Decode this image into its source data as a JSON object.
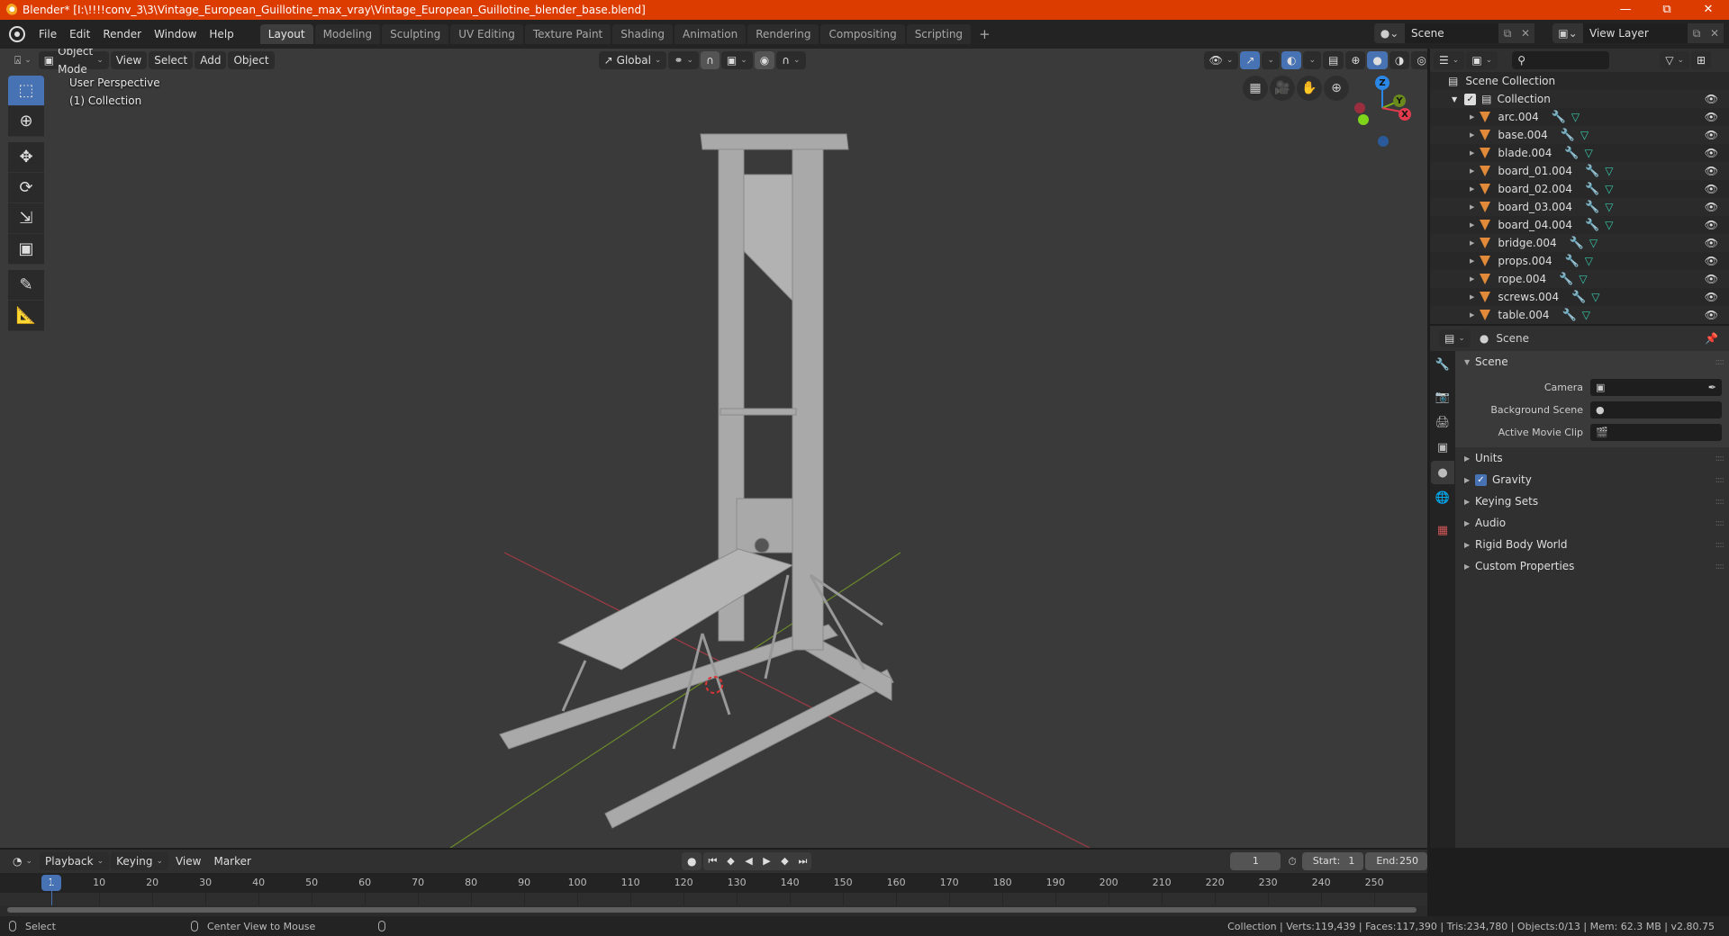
{
  "window": {
    "title": "Blender* [I:\\!!!!conv_3\\3\\Vintage_European_Guillotine_max_vray\\Vintage_European_Guillotine_blender_base.blend]",
    "controls": [
      "minimize",
      "restore",
      "close"
    ]
  },
  "menu": {
    "items": [
      "File",
      "Edit",
      "Render",
      "Window",
      "Help"
    ]
  },
  "workspaces": {
    "tabs": [
      "Layout",
      "Modeling",
      "Sculpting",
      "UV Editing",
      "Texture Paint",
      "Shading",
      "Animation",
      "Rendering",
      "Compositing",
      "Scripting"
    ],
    "active": "Layout",
    "add_label": "+"
  },
  "scene_selector": {
    "name": "Scene"
  },
  "view_layer_selector": {
    "name": "View Layer"
  },
  "viewport_header": {
    "mode": "Object Mode",
    "menus": [
      "View",
      "Select",
      "Add",
      "Object"
    ],
    "orientation": "Global"
  },
  "viewport": {
    "perspective_label": "User Perspective",
    "collection_label": "(1) Collection",
    "gizmo_axes": [
      "Z",
      "Y",
      "X"
    ],
    "colors": {
      "x_axis": "#e23b4e",
      "y_axis": "#7fb515",
      "z_axis": "#2b87e6",
      "background": "#3a3a3a"
    }
  },
  "tools": [
    "select-box",
    "cursor",
    "move",
    "rotate",
    "scale",
    "transform",
    "annotate",
    "measure"
  ],
  "outliner": {
    "root": "Scene Collection",
    "collection": "Collection",
    "objects": [
      "arc.004",
      "base.004",
      "blade.004",
      "board_01.004",
      "board_02.004",
      "board_03.004",
      "board_04.004",
      "bridge.004",
      "props.004",
      "rope.004",
      "screws.004",
      "table.004"
    ]
  },
  "properties": {
    "context": "Scene",
    "panel_title": "Scene",
    "fields": [
      {
        "label": "Camera",
        "value": ""
      },
      {
        "label": "Background Scene",
        "value": ""
      },
      {
        "label": "Active Movie Clip",
        "value": ""
      }
    ],
    "sections": [
      "Units",
      "Gravity",
      "Keying Sets",
      "Audio",
      "Rigid Body World",
      "Custom Properties"
    ],
    "gravity_checked": true
  },
  "timeline": {
    "menus": [
      "Playback",
      "Keying",
      "View",
      "Marker"
    ],
    "current_frame": "1",
    "start_label": "Start:",
    "start": "1",
    "end_label": "End:",
    "end": "250",
    "ticks": [
      "10",
      "20",
      "30",
      "40",
      "50",
      "60",
      "70",
      "80",
      "90",
      "100",
      "110",
      "120",
      "130",
      "140",
      "150",
      "160",
      "170",
      "180",
      "190",
      "200",
      "210",
      "220",
      "230",
      "240",
      "250"
    ]
  },
  "statusbar": {
    "left_action": "Select",
    "middle_action": "Center View to Mouse",
    "stats": "Collection | Verts:119,439 | Faces:117,390 | Tris:234,780 | Objects:0/13 | Mem: 62.3 MB | v2.80.75"
  }
}
